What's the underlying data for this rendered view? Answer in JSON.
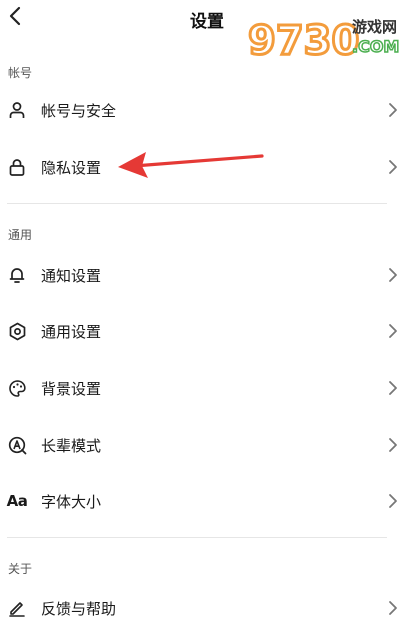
{
  "header": {
    "title": "设置",
    "back_icon": "chevron-left-icon"
  },
  "watermark": {
    "brand_number": "9730",
    "brand_text": "游戏网",
    "brand_suffix": ".COM"
  },
  "sections": {
    "account": {
      "label": "帐号",
      "items": [
        {
          "label": "帐号与安全",
          "icon": "user-icon"
        },
        {
          "label": "隐私设置",
          "icon": "lock-icon"
        }
      ]
    },
    "general": {
      "label": "通用",
      "items": [
        {
          "label": "通知设置",
          "icon": "bell-icon"
        },
        {
          "label": "通用设置",
          "icon": "gear-icon"
        },
        {
          "label": "背景设置",
          "icon": "palette-icon"
        },
        {
          "label": "长辈模式",
          "icon": "elder-mode-icon"
        },
        {
          "label": "字体大小",
          "icon": "font-size-icon",
          "icon_text": "Aa"
        }
      ]
    },
    "about": {
      "label": "关于",
      "items": [
        {
          "label": "反馈与帮助",
          "icon": "pencil-icon"
        }
      ]
    }
  },
  "annotation": {
    "color": "#e53935"
  }
}
